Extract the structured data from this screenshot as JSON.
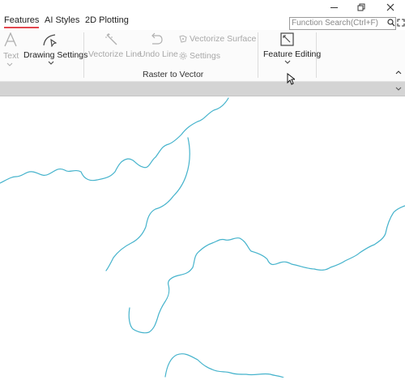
{
  "window": {
    "restore_icon": "restore-icon",
    "close_icon": "close-icon",
    "minimize_icon": "minimize-icon"
  },
  "tabs": [
    {
      "label": "Features",
      "active": true
    },
    {
      "label": "AI Styles"
    },
    {
      "label": "2D Plotting"
    }
  ],
  "search": {
    "placeholder": "Function Search(Ctrl+F)"
  },
  "ribbon": {
    "text_label": "Text",
    "drawing_settings_label": "Drawing Settings",
    "vectorize_line_label": "Vectorize Line",
    "undo_line_label": "Undo Line",
    "vectorize_surface_label": "Vectorize Surface",
    "settings_label": "Settings",
    "raster_group_label": "Raster to Vector",
    "feature_editing_label": "Feature Editing"
  },
  "colors": {
    "accent": "#e2474f",
    "contour": "#45b3cc",
    "subbar": "#d4d4d4"
  }
}
